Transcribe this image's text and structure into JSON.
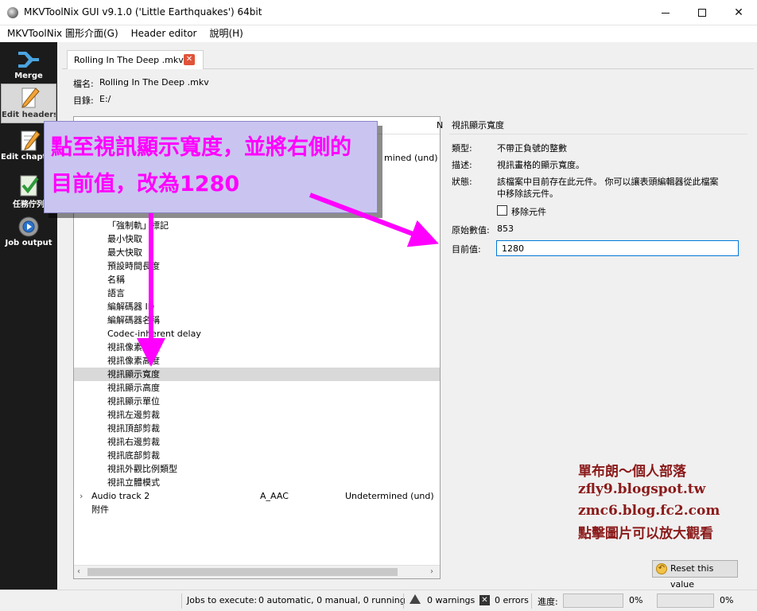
{
  "window": {
    "title": "MKVToolNix GUI v9.1.0 ('Little Earthquakes') 64bit",
    "minimize_label": "",
    "maximize_label": "",
    "close_label": "✕"
  },
  "menu": [
    "MKVToolNix 圖形介面(G)",
    "Header editor",
    "說明(H)"
  ],
  "toolbar": {
    "merge": "Merge",
    "edit_headers": "Edit headers",
    "edit_chapters": "Edit chapters",
    "job_queue": "任務佇列",
    "job_output": "Job output"
  },
  "tab": {
    "label": "Rolling In The Deep .mkv",
    "close": "✕"
  },
  "file": {
    "name_label": "檔名:",
    "name_value": "Rolling In The Deep .mkv",
    "dir_label": "目錄:",
    "dir_value": "E:/"
  },
  "tree": {
    "header_partial": "N",
    "row_partial_lang": "mined (und)",
    "rows": [
      "「強制軌」標記",
      "最小快取",
      "最大快取",
      "預設時間長度",
      "名稱",
      "語言",
      "編解碼器 ID",
      "編解碼器名稱",
      "Codec-inherent delay",
      "視訊像素寬度",
      "視訊像素高度",
      "視訊顯示寬度",
      "視訊顯示高度",
      "視訊顯示單位",
      "視訊左邊剪裁",
      "視訊頂部剪裁",
      "視訊右邊剪裁",
      "視訊底部剪裁",
      "視訊外觀比例類型",
      "視訊立體模式"
    ],
    "selected_index": 11,
    "audio_track": {
      "name": "Audio track 2",
      "codec": "A_AAC",
      "language": "Undetermined (und)",
      "expander": "›"
    },
    "attachments": "附件",
    "scroll_left": "‹",
    "scroll_right": "›"
  },
  "details": {
    "title": "視訊顯示寬度",
    "type_label": "類型:",
    "type_value": "不帶正負號的整數",
    "desc_label": "描述:",
    "desc_value": "視訊畫格的顯示寬度。",
    "status_label": "狀態:",
    "status_value_1": "該檔案中目前存在此元件。 你可以讓表頭編輯器從此檔案",
    "status_value_2": "中移除該元件。",
    "remove_label": "移除元件",
    "orig_label": "原始數值:",
    "orig_value": "853",
    "current_label": "目前值:",
    "current_value": "1280",
    "reset_label": "Reset this value"
  },
  "status": {
    "jobs_label": "Jobs to execute:",
    "jobs_value": "0 automatic, 0 manual, 0 running",
    "warnings": "0 warnings",
    "errors": "0 errors",
    "progress_label": "進度:",
    "progress_1": "0%",
    "progress_2": "0%"
  },
  "annotation": {
    "line1": "點至視訊顯示寬度，並將右側的",
    "line2": "目前值，改為1280"
  },
  "credits": [
    "單布朗～個人部落",
    "zfly9.blogspot.tw",
    "zmc6.blog.fc2.com",
    "點擊圖片可以放大觀看"
  ],
  "colors": {
    "annotation_text": "#ff00ff",
    "annotation_bg": "#c9c5f0",
    "credit": "#8b1a1a",
    "toolbar_bg": "#1b1b1b"
  }
}
